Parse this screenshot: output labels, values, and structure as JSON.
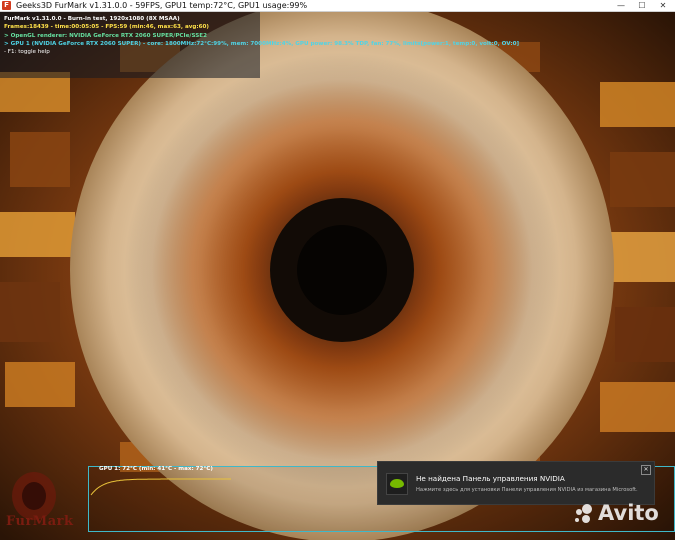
{
  "window": {
    "title": "Geeks3D FurMark v1.31.0.0 - 59FPS, GPU1 temp:72°C, GPU1 usage:99%",
    "app_icon": "furmark-icon",
    "controls": {
      "minimize": "—",
      "maximize": "☐",
      "close": "✕"
    }
  },
  "osd": {
    "lines": [
      "FurMark v1.31.0.0 - Burn-in test, 1920x1080 (8X MSAA)",
      "Frames:18439 - time:00:05:05 - FPS:59 (min:46, max:63, avg:60)",
      "> OpenGL renderer: NVIDIA GeForce RTX 2060 SUPER/PCIe/SSE2",
      "> GPU 1 (NVIDIA GeForce RTX 2060 SUPER) - core: 1800MHz:72°C:99%, mem: 7000MHz:4%, GPU power: 98.3% TDP, fan: 77%, limits[power:1, temp:0, volt:0, OV:0]",
      "- F1: toggle help"
    ]
  },
  "temp_graph": {
    "label": "GPU 1: 72°C (min: 41°C - max: 72°C)",
    "min": 41,
    "max": 72,
    "current": 72,
    "line_color": "#e8c23a"
  },
  "logo": {
    "text": "FurMark"
  },
  "notification": {
    "title": "Не найдена Панель управления NVIDIA",
    "body": "Нажмите здесь для установки Панели управления NVIDIA из магазина Microsoft.",
    "icon": "nvidia-icon",
    "close": "✕"
  },
  "watermark": {
    "text": "Avito"
  },
  "colors": {
    "accent_cyan": "#4fd4e6",
    "osd_yellow": "#ffe14a",
    "nvidia_green": "#76b900"
  }
}
